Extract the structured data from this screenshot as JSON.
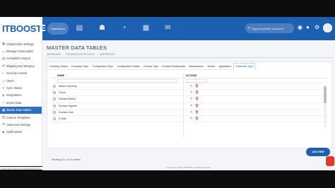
{
  "app": {
    "logo": "ITBOOST"
  },
  "topbar": {
    "nav_active_label": "Dashboard",
    "search_placeholder": "Type anywhere to search"
  },
  "sidebar": {
    "items": [
      {
        "label": "Organization Settings",
        "icon": "building-icon"
      },
      {
        "label": "Manage Subscription",
        "icon": "card-icon"
      },
      {
        "label": "Completion Report",
        "icon": "report-icon"
      },
      {
        "label": "Mapping and Merging",
        "icon": "merge-icon"
      },
      {
        "label": "Security Control",
        "icon": "lock-icon"
      },
      {
        "label": "Users",
        "icon": "user-icon"
      },
      {
        "label": "Sync Status",
        "icon": "sync-icon"
      },
      {
        "label": "Integrations",
        "icon": "plug-icon"
      },
      {
        "label": "Import Data",
        "icon": "import-icon"
      },
      {
        "label": "Master Data Tables",
        "icon": "table-icon"
      },
      {
        "label": "Custom Templates",
        "icon": "template-icon"
      },
      {
        "label": "Advanced Settings",
        "icon": "gear-icon"
      },
      {
        "label": "Notifications",
        "icon": "bell-icon"
      }
    ],
    "active_index": 9
  },
  "page": {
    "title": "MASTER DATA TABLES",
    "breadcrumb": [
      "DASHBOARD",
      "ORGANIZATION SETTINGS",
      "MASTERDATA"
    ]
  },
  "tabs": [
    "Company Status",
    "Company Type",
    "Configuration Type",
    "Configuration Status",
    "Contact Type",
    "Contact Relationship",
    "Manufacturer",
    "Vendor",
    "Application",
    "Password Type"
  ],
  "active_tab": "Password Type",
  "grid": {
    "headers": {
      "name": "NAME",
      "actions": "ACTIONS"
    },
    "rows": [
      "Active Directory",
      "Cloud",
      "Domain Admin",
      "Domain register",
      "Domain User",
      "E-Mail"
    ],
    "footer": "Showing 1 to 7 of 16 entries"
  },
  "buttons": {
    "add_new": "ADD NEW"
  },
  "footer": {
    "copyright": "Copyright © 2021 ITBOOST. All rights reserved."
  },
  "status_url": "https://app.itboost.com/#/app/dashboard",
  "colors": {
    "brand": "#1d5fb0",
    "active": "#2f6fc3",
    "delete": "#d04848"
  }
}
